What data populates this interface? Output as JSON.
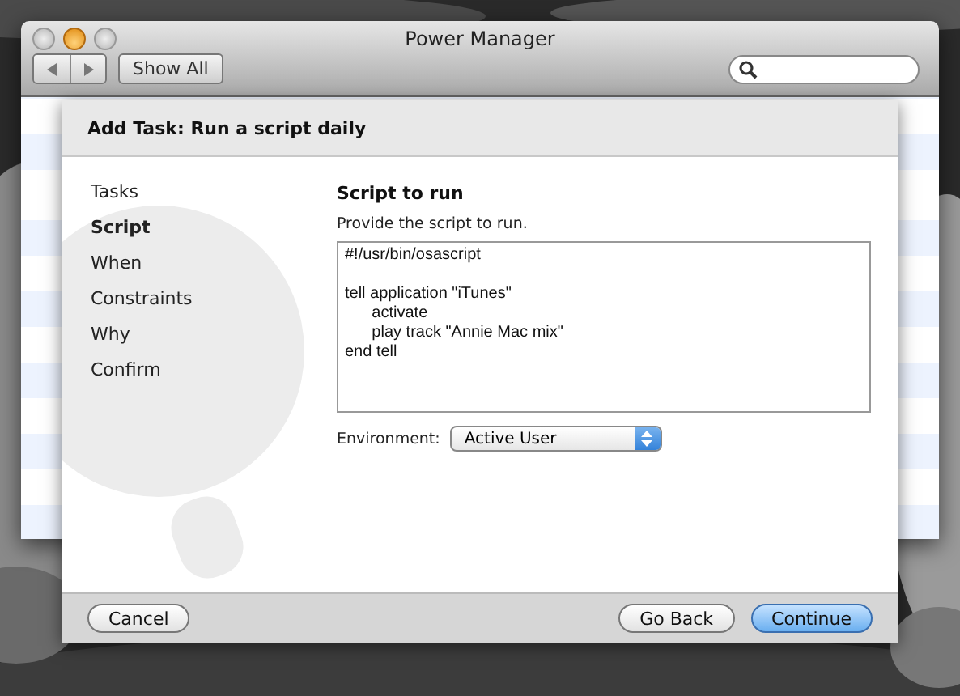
{
  "window": {
    "title": "Power Manager"
  },
  "toolbar": {
    "show_all": "Show All"
  },
  "sheet": {
    "title": "Add Task: Run a script daily",
    "steps": [
      {
        "label": "Tasks",
        "selected": false
      },
      {
        "label": "Script",
        "selected": true
      },
      {
        "label": "When",
        "selected": false
      },
      {
        "label": "Constraints",
        "selected": false
      },
      {
        "label": "Why",
        "selected": false
      },
      {
        "label": "Confirm",
        "selected": false
      }
    ],
    "heading": "Script to run",
    "instruction": "Provide the script to run.",
    "script": "#!/usr/bin/osascript\n\ntell application \"iTunes\"\n\tactivate\n\tplay track \"Annie Mac mix\"\nend tell",
    "environment": {
      "label": "Environment:",
      "value": "Active User"
    },
    "buttons": [
      {
        "label": "Cancel",
        "kind": "plain"
      },
      {
        "label": "Go Back",
        "kind": "plain"
      },
      {
        "label": "Continue",
        "kind": "default"
      }
    ]
  }
}
